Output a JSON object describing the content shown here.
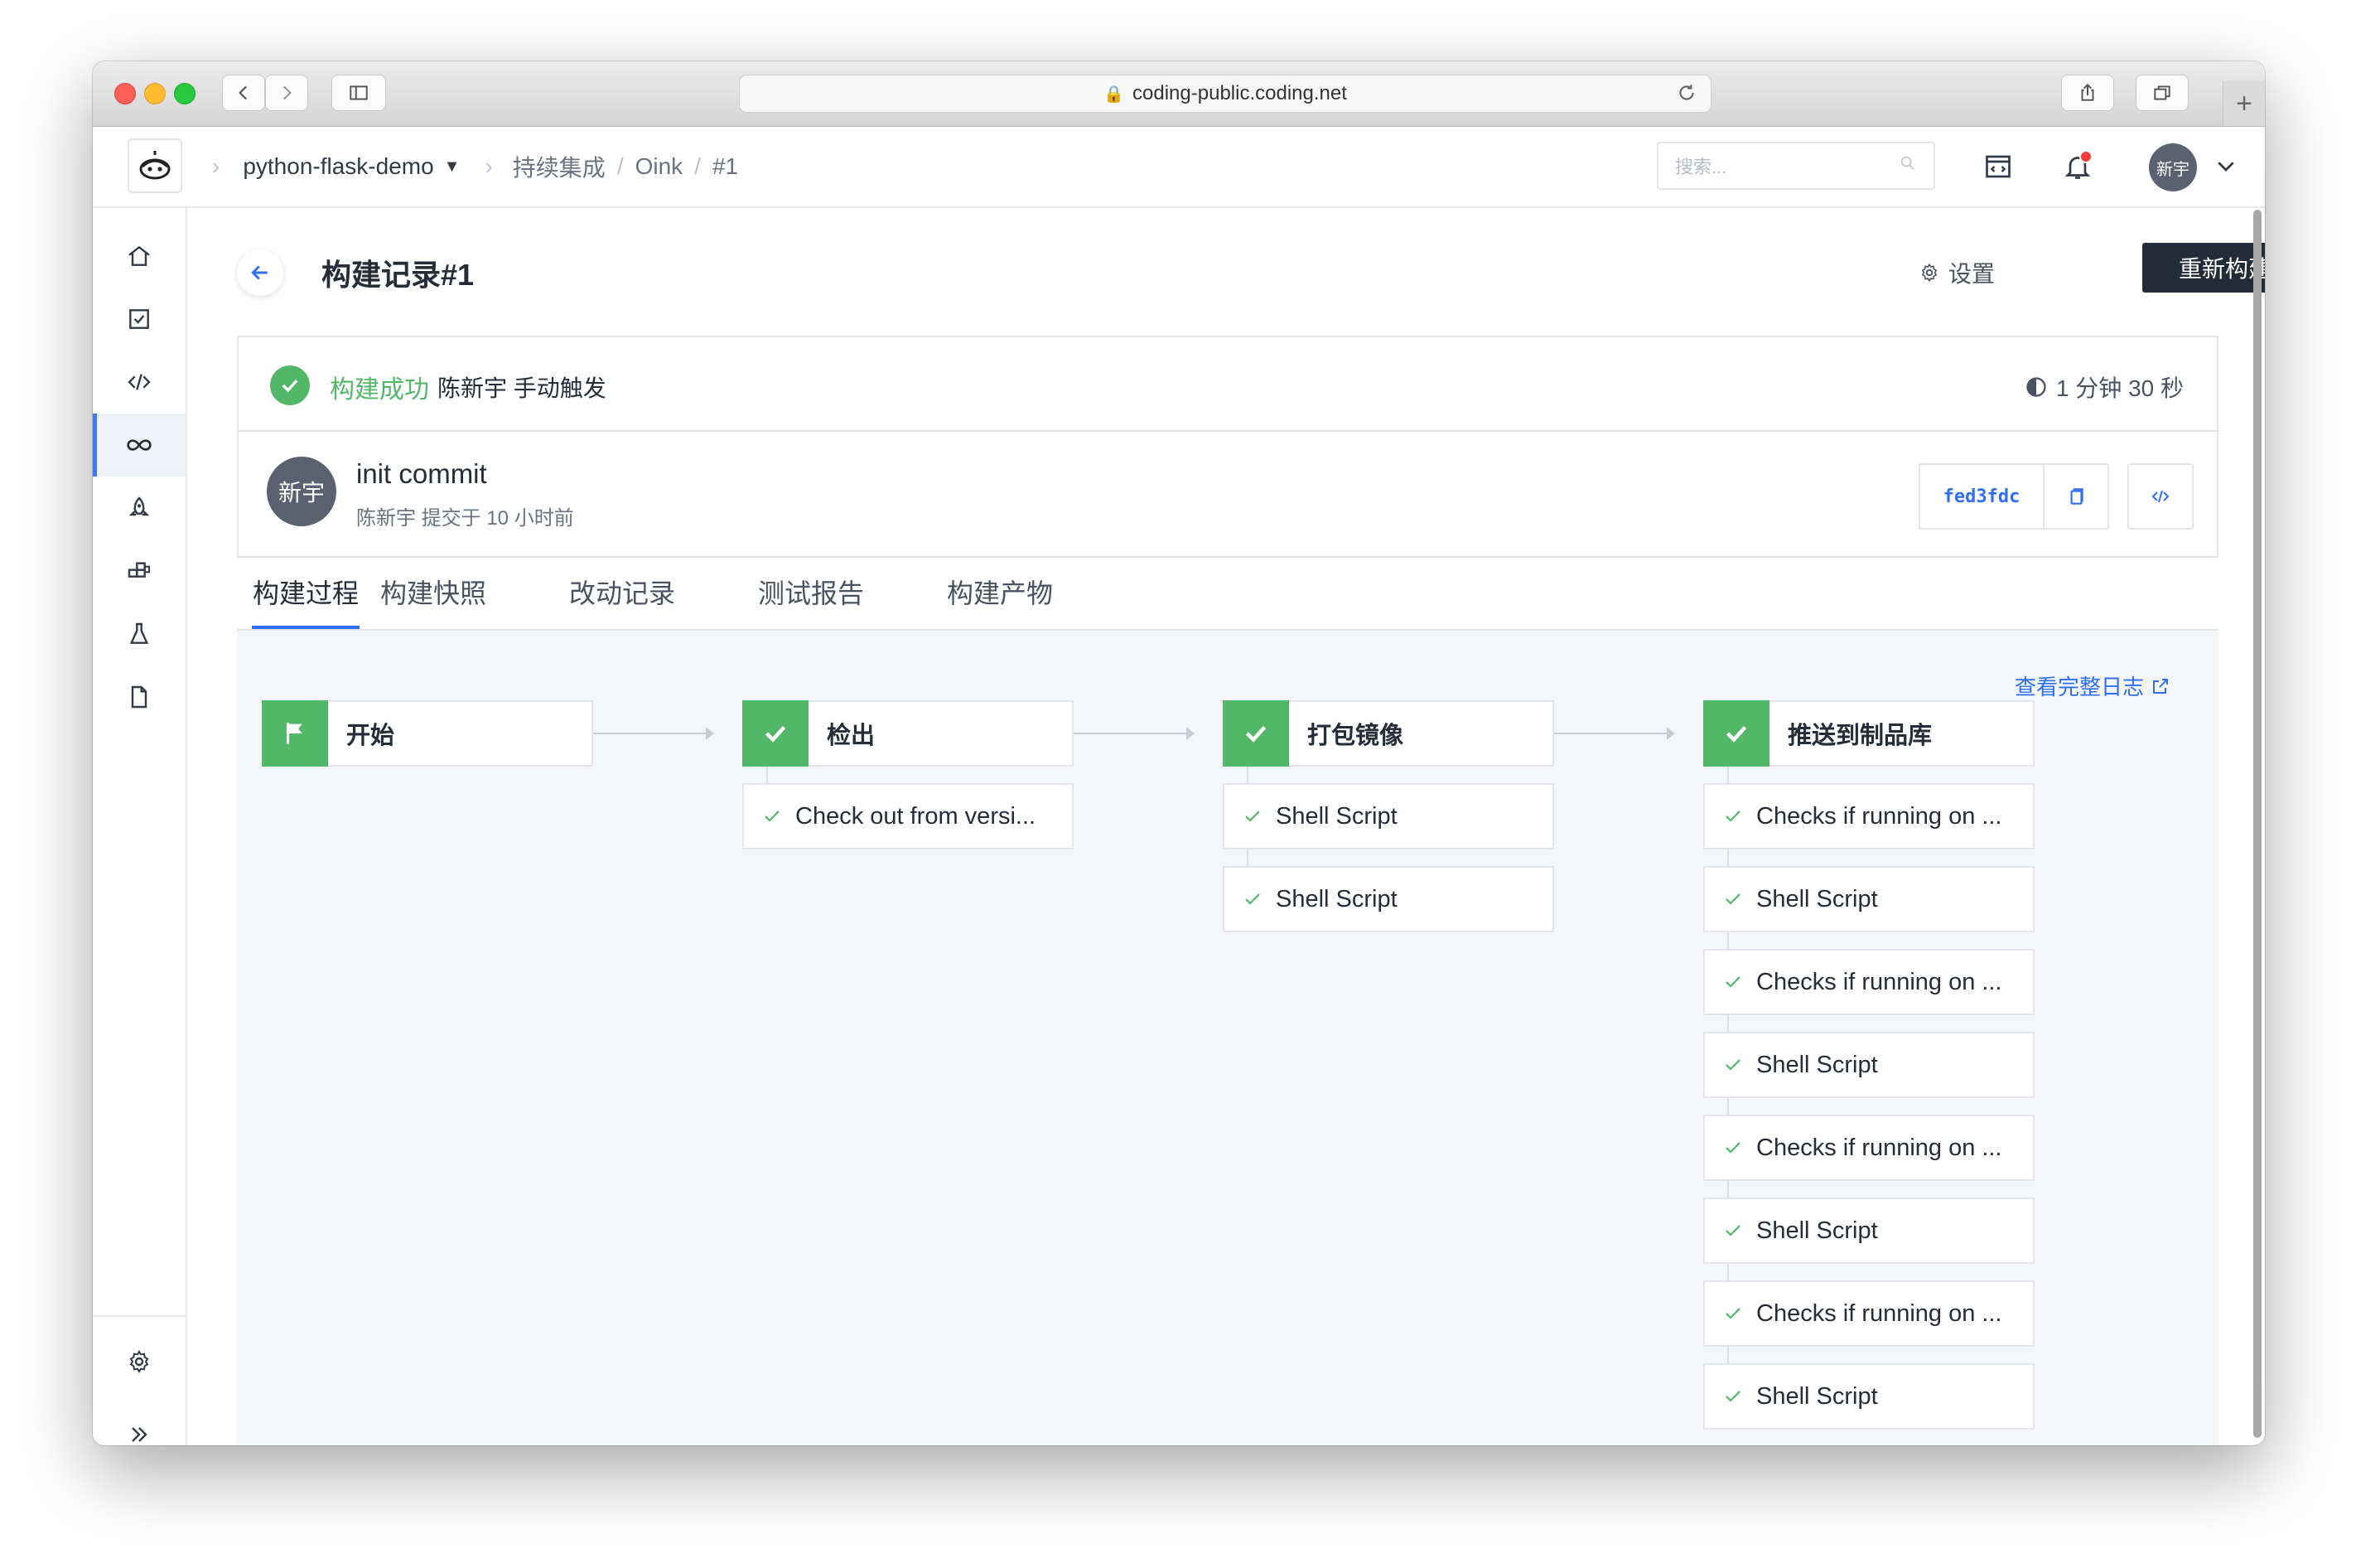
{
  "browser": {
    "url": "coding-public.coding.net"
  },
  "topnav": {
    "project": "python-flask-demo",
    "crumbs": [
      "持续集成",
      "Oink",
      "#1"
    ],
    "search_placeholder": "搜索...",
    "avatar_text": "新宇"
  },
  "page": {
    "title": "构建记录#1",
    "settings_label": "设置",
    "rebuild_label": "重新构建"
  },
  "status": {
    "result": "构建成功",
    "trigger": "陈新宇 手动触发",
    "duration": "1 分钟 30 秒"
  },
  "commit": {
    "avatar_text": "新宇",
    "message": "init commit",
    "meta": "陈新宇 提交于 10 小时前",
    "sha": "fed3fdc"
  },
  "tabs": [
    "构建过程",
    "构建快照",
    "改动记录",
    "测试报告",
    "构建产物"
  ],
  "pipeline": {
    "full_log_label": "查看完整日志",
    "stages": [
      {
        "name": "开始",
        "icon": "flag-icon",
        "steps": []
      },
      {
        "name": "检出",
        "icon": "check-icon",
        "steps": [
          "Check out from versi..."
        ]
      },
      {
        "name": "打包镜像",
        "icon": "check-icon",
        "steps": [
          "Shell Script",
          "Shell Script"
        ]
      },
      {
        "name": "推送到制品库",
        "icon": "check-icon",
        "steps": [
          "Checks if running on ...",
          "Shell Script",
          "Checks if running on ...",
          "Shell Script",
          "Checks if running on ...",
          "Shell Script",
          "Checks if running on ...",
          "Shell Script"
        ]
      }
    ]
  },
  "colors": {
    "success": "#52b768",
    "accent": "#2f6ff5",
    "primary_button": "#222b38"
  }
}
